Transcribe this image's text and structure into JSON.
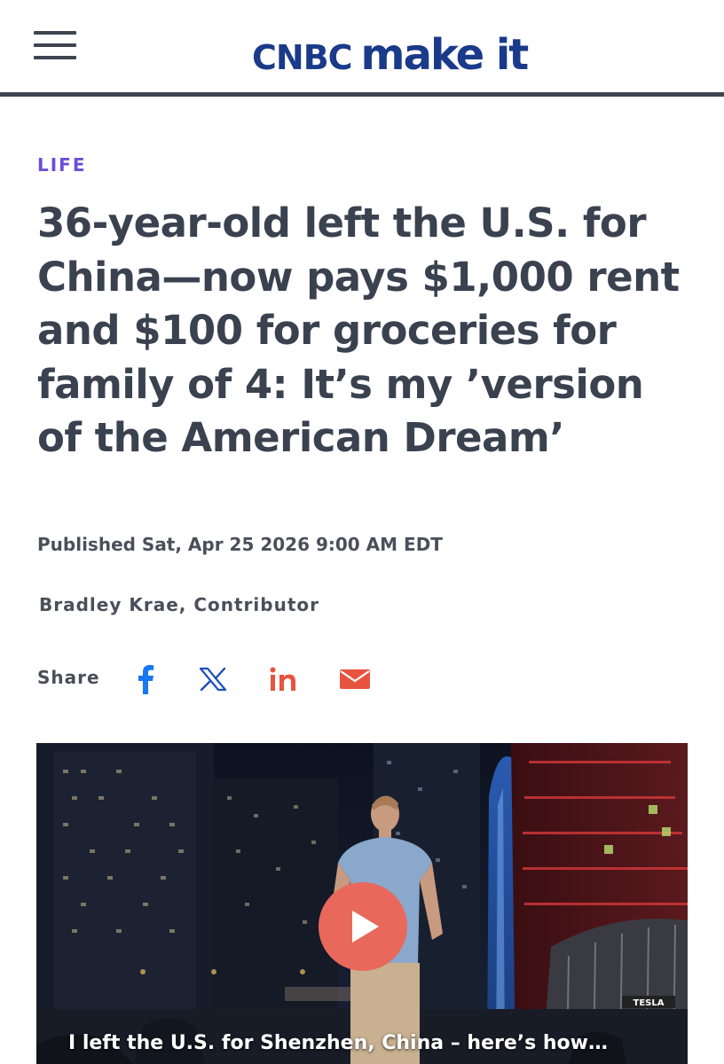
{
  "header": {
    "logo_cnbc": "CNBC",
    "logo_make_it": "make it",
    "menu_icon": "hamburger-menu-icon",
    "brand_color": "#1a3a8a"
  },
  "article": {
    "section": "LIFE",
    "section_color": "#6a4fd8",
    "headline": "36-year-old left the U.S. for China—now pays $1,000 rent and $100 for groceries for family of 4: It’s my ’version of the American Dream’",
    "published": "Published Sat, Apr 25 2026 9:00 AM EDT",
    "author": "Bradley Krae, Contributor"
  },
  "share": {
    "label": "Share",
    "icons": [
      "facebook-icon",
      "x-twitter-icon",
      "linkedin-icon",
      "email-icon"
    ]
  },
  "video": {
    "caption": "I left the U.S. for Shenzhen, China – here’s how…",
    "play_icon": "play-icon",
    "play_color": "#e8695c",
    "sign_text": "TESLA"
  }
}
